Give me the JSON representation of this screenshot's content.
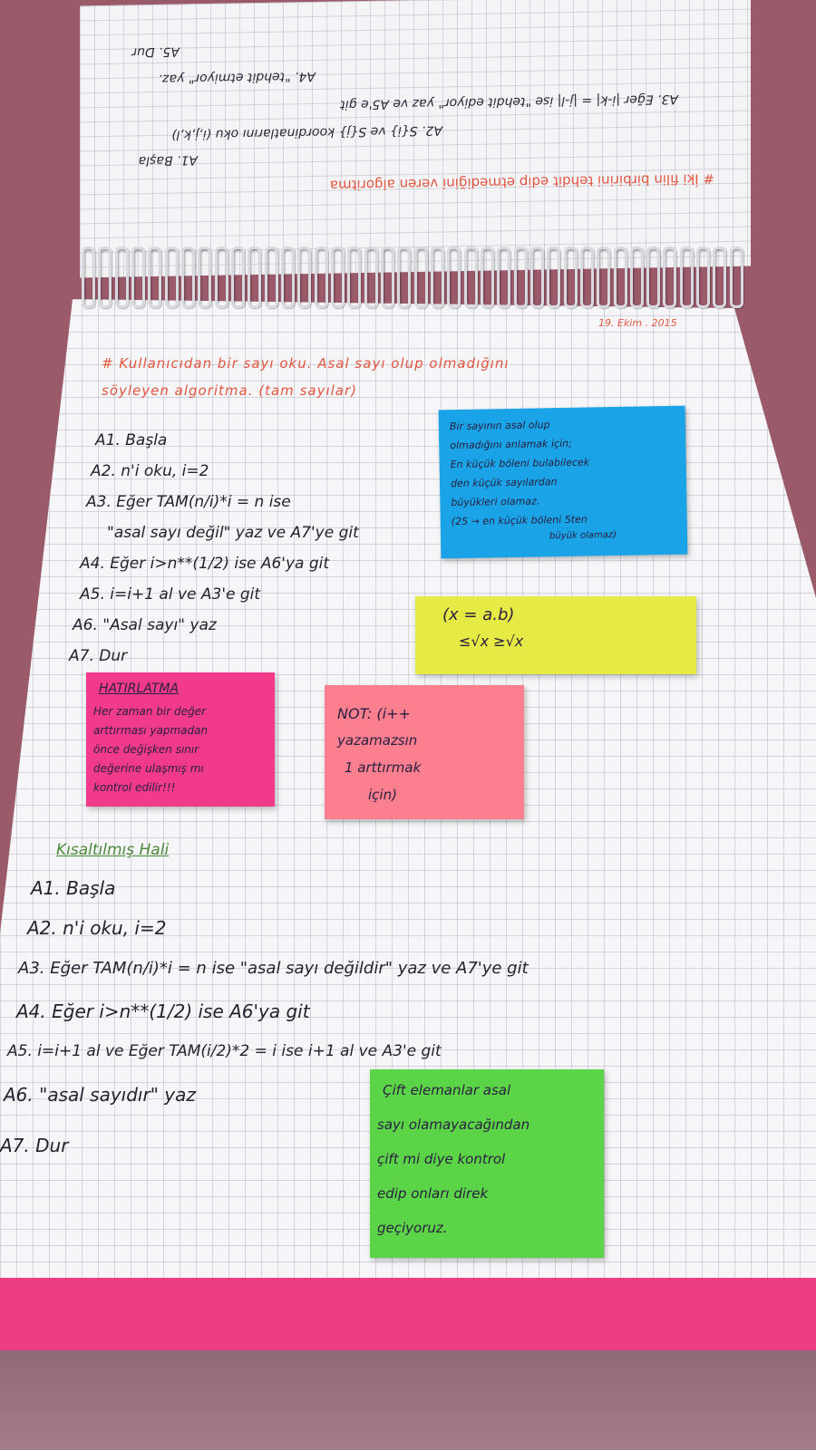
{
  "upper_page": {
    "title": "# İki filin birbirini tehdit edip etmediğini veren algoritma",
    "lines": [
      "A1. Başla",
      "A2. S{i} ve S{j} koordinatlarını oku (i,j,k,l)",
      "A3. Eğer |i-k| = |j-l| ise \"tehdit ediyor\" yaz ve A5'e git",
      "A4. \"tehdit etmiyor\" yaz.",
      "A5. Dur"
    ]
  },
  "date": "19. Ekim . 2015",
  "heading": {
    "line1": "# Kullanıcıdan bir sayı oku. Asal sayı olup olmadığını",
    "line2": "söyleyen algoritma. (tam sayılar)"
  },
  "algo1": [
    "A1. Başla",
    "A2. n'i oku, i=2",
    "A3. Eğer TAM(n/i)*i = n ise",
    "\"asal sayı değil\" yaz ve A7'ye git",
    "A4. Eğer i>n**(1/2) ise A6'ya git",
    "A5. i=i+1 al ve A3'e git",
    "A6. \"Asal sayı\" yaz",
    "A7. Dur"
  ],
  "blue_note": [
    "Bir sayının asal olup",
    "olmadığını anlamak için;",
    "En küçük böleni bulabilecek",
    "den küçük sayılardan",
    "büyükleri olamaz.",
    "(25 → en küçük böleni 5ten",
    "büyük olamaz)"
  ],
  "yellow_note": {
    "line1": "(x = a.b)",
    "line2": "≤√x ≥√x"
  },
  "pink_note": {
    "title": "HATIRLATMA",
    "lines": [
      "Her zaman bir değer",
      "arttırması yapmadan",
      "önce değişken sınır",
      "değerine ulaşmış mı",
      "kontrol edilir!!!"
    ]
  },
  "salmon_note": {
    "lines": [
      "NOT: (i++",
      "yazamazsın",
      "1 arttırmak",
      "için)"
    ]
  },
  "short_title": "Kısaltılmış Hali",
  "algo2": [
    "A1. Başla",
    "A2. n'i oku, i=2",
    "A3. Eğer TAM(n/i)*i = n ise \"asal sayı değildir\" yaz ve A7'ye git",
    "A4. Eğer i>n**(1/2) ise A6'ya git",
    "A5. i=i+1 al ve Eğer TAM(i/2)*2 = i ise i+1 al ve A3'e git",
    "A6. \"asal sayıdır\" yaz",
    "A7. Dur"
  ],
  "green_note": [
    "Çift elemanlar asal",
    "sayı olamayacağından",
    "çift mi diye kontrol",
    "edip onları direk",
    "geçiyoruz."
  ],
  "colors": {
    "blue_note": "#1aa3e6",
    "yellow_note": "#e6ea44",
    "pink_note": "#f23a8a",
    "salmon_note": "#fb7f8f",
    "green_note": "#5cd448",
    "red_ink": "#e2553f"
  }
}
